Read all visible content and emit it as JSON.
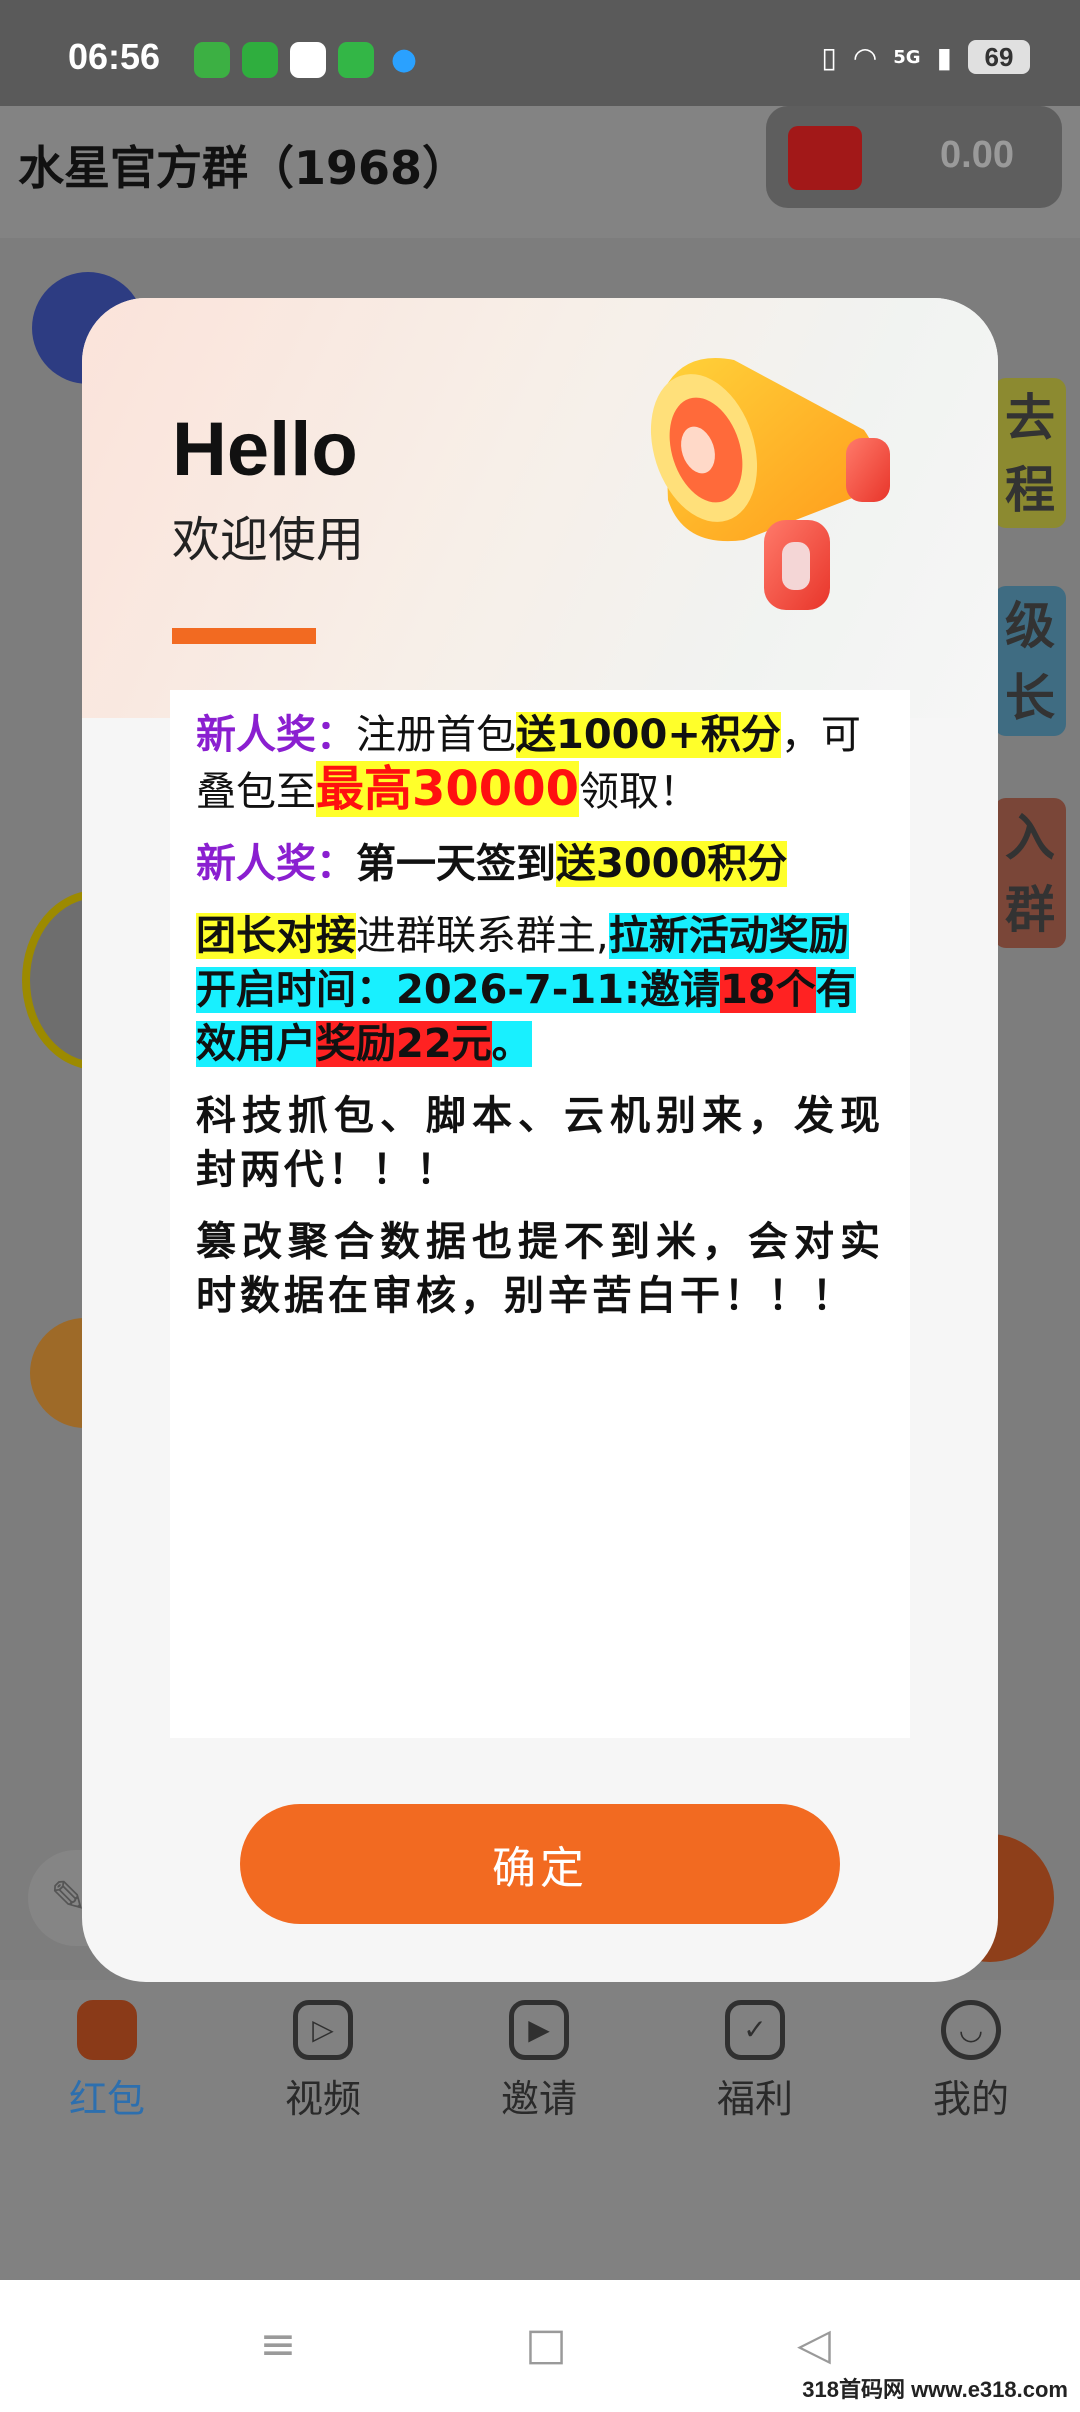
{
  "status_bar": {
    "time": "06:56",
    "network": "5G",
    "battery": "69"
  },
  "header": {
    "title": "水星官方群（1968）",
    "wallet_amount": "0.00"
  },
  "side_badges": [
    "去程",
    "级长",
    "入群"
  ],
  "modal": {
    "hello": "Hello",
    "subtitle": "欢迎使用",
    "paragraphs": {
      "p1": {
        "label": "新人奖：",
        "t1": "注册首包",
        "hl1": "送1000+积分",
        "t2": "，可叠包至",
        "big": "最高30000",
        "t3": "领取！"
      },
      "p2": {
        "label": "新人奖：",
        "t1": "第一天签到",
        "hl1": "送3000积分"
      },
      "p3": {
        "hl_y": "团长对接",
        "t1": "进群联系群主,",
        "hl_c1": "拉新活动奖励开启时间：2026-7-11:邀请",
        "hl_r1": "18个",
        "hl_c2": "有效用户",
        "hl_r2": "奖励22元",
        "hl_c3": "。"
      },
      "p4": "科技抓包、脚本、云机别来，发现封两代！！！",
      "p5": "篡改聚合数据也提不到米，会对实时数据在审核，别辛苦白干！！！"
    },
    "confirm_label": "确定"
  },
  "tabs": [
    {
      "label": "红包",
      "icon": "red-packet-icon"
    },
    {
      "label": "视频",
      "icon": "video-icon"
    },
    {
      "label": "邀请",
      "icon": "tv-icon"
    },
    {
      "label": "福利",
      "icon": "gift-icon"
    },
    {
      "label": "我的",
      "icon": "user-icon"
    }
  ],
  "nav": {
    "menu": "≡",
    "home": "□",
    "back": "◁"
  },
  "watermark": "318首码网 www.e318.com",
  "colors": {
    "accent": "#f26a21",
    "purple": "#8a1fd0",
    "highlight_yellow": "#ffff2a",
    "highlight_cyan": "#18f0ff",
    "highlight_red": "#ff2222"
  }
}
